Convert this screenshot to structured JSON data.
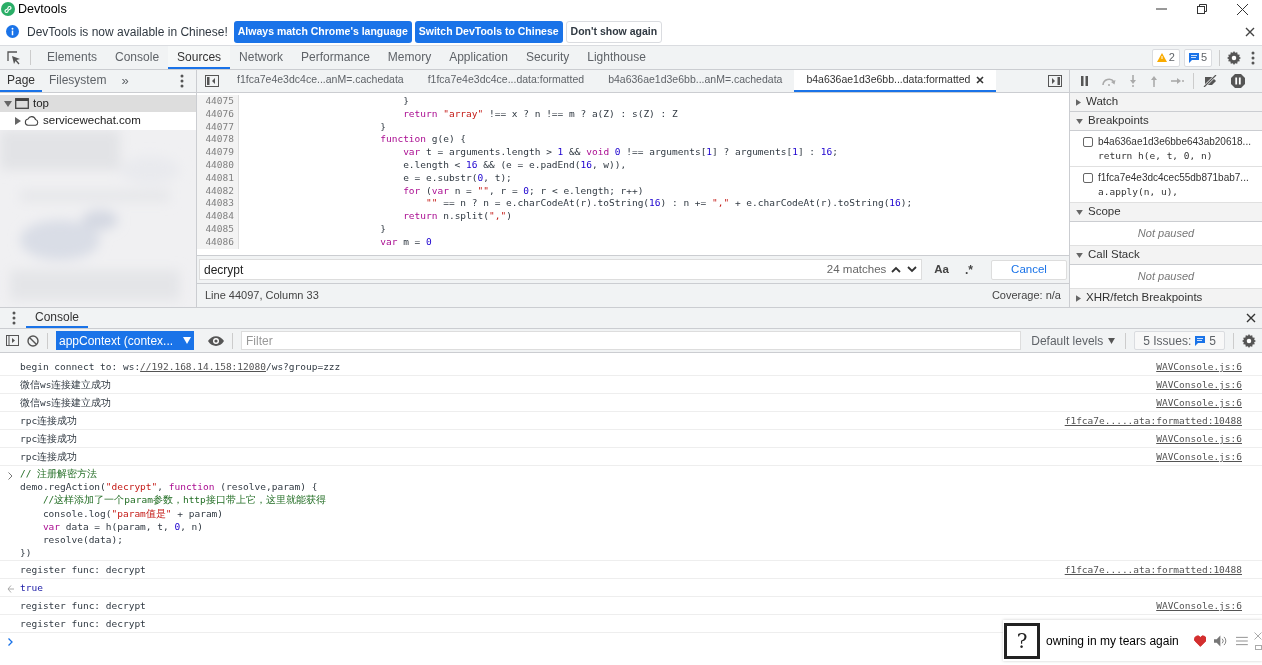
{
  "window": {
    "title": "Devtools"
  },
  "infobar": {
    "message": "DevTools is now available in Chinese!",
    "buttons": [
      {
        "label": "Always match Chrome's language",
        "primary": true
      },
      {
        "label": "Switch DevTools to Chinese",
        "primary": true
      },
      {
        "label": "Don't show again",
        "primary": false
      }
    ]
  },
  "main_tabs": [
    {
      "label": "Elements",
      "selected": false
    },
    {
      "label": "Console",
      "selected": false
    },
    {
      "label": "Sources",
      "selected": true
    },
    {
      "label": "Network",
      "selected": false
    },
    {
      "label": "Performance",
      "selected": false
    },
    {
      "label": "Memory",
      "selected": false
    },
    {
      "label": "Application",
      "selected": false
    },
    {
      "label": "Security",
      "selected": false
    },
    {
      "label": "Lighthouse",
      "selected": false
    }
  ],
  "badges": {
    "warnings": "2",
    "messages": "5"
  },
  "navigator": {
    "tabs": [
      {
        "label": "Page",
        "selected": true
      },
      {
        "label": "Filesystem",
        "selected": false
      }
    ],
    "more": "»",
    "tree": [
      {
        "label": "top",
        "kind": "frame",
        "selected": true,
        "expanded": true,
        "children": [
          {
            "label": "servicewechat.com",
            "kind": "domain",
            "selected": false,
            "expanded": false
          }
        ]
      }
    ]
  },
  "editor": {
    "tabs": [
      {
        "label": "f1fca7e4e3dc4ce...anM=.cachedata",
        "selected": false
      },
      {
        "label": "f1fca7e4e3dc4ce...data:formatted",
        "selected": false
      },
      {
        "label": "b4a636ae1d3e6bb...anM=.cachedata",
        "selected": false
      },
      {
        "label": "b4a636ae1d3e6bb...data:formatted",
        "selected": true
      }
    ],
    "lines": [
      {
        "number": "44075",
        "tokens": [
          {
            "kind": "plain",
            "text": "                            }"
          }
        ]
      },
      {
        "number": "44076",
        "tokens": [
          {
            "kind": "keyword",
            "text": "                            return"
          },
          {
            "kind": "string",
            "text": " \"array\""
          },
          {
            "kind": "plain",
            "text": " !== x ? n !== m ? a(Z) : s(Z) : Z"
          }
        ]
      },
      {
        "number": "44077",
        "tokens": [
          {
            "kind": "plain",
            "text": "                        }"
          }
        ]
      },
      {
        "number": "44078",
        "tokens": [
          {
            "kind": "keyword",
            "text": "                        function"
          },
          {
            "kind": "plain",
            "text": " g(e) {"
          }
        ]
      },
      {
        "number": "44079",
        "tokens": [
          {
            "kind": "keyword",
            "text": "                            var"
          },
          {
            "kind": "plain",
            "text": " t = arguments.length > "
          },
          {
            "kind": "number",
            "text": "1"
          },
          {
            "kind": "plain",
            "text": " && "
          },
          {
            "kind": "keyword",
            "text": "void"
          },
          {
            "kind": "number",
            "text": " 0"
          },
          {
            "kind": "plain",
            "text": " !== arguments["
          },
          {
            "kind": "number",
            "text": "1"
          },
          {
            "kind": "plain",
            "text": "] ? arguments["
          },
          {
            "kind": "number",
            "text": "1"
          },
          {
            "kind": "plain",
            "text": "] : "
          },
          {
            "kind": "number",
            "text": "16"
          },
          {
            "kind": "plain",
            "text": ";"
          }
        ]
      },
      {
        "number": "44080",
        "tokens": [
          {
            "kind": "plain",
            "text": "                            e.length < "
          },
          {
            "kind": "number",
            "text": "16"
          },
          {
            "kind": "plain",
            "text": " && (e = e.padEnd("
          },
          {
            "kind": "number",
            "text": "16"
          },
          {
            "kind": "plain",
            "text": ", w)),"
          }
        ]
      },
      {
        "number": "44081",
        "tokens": [
          {
            "kind": "plain",
            "text": "                            e = e.substr("
          },
          {
            "kind": "number",
            "text": "0"
          },
          {
            "kind": "plain",
            "text": ", t);"
          }
        ]
      },
      {
        "number": "44082",
        "tokens": [
          {
            "kind": "keyword",
            "text": "                            for"
          },
          {
            "kind": "plain",
            "text": " ("
          },
          {
            "kind": "keyword",
            "text": "var"
          },
          {
            "kind": "plain",
            "text": " n = "
          },
          {
            "kind": "string",
            "text": "\"\""
          },
          {
            "kind": "plain",
            "text": ", r = "
          },
          {
            "kind": "number",
            "text": "0"
          },
          {
            "kind": "plain",
            "text": "; r < e.length; r++)"
          }
        ]
      },
      {
        "number": "44083",
        "tokens": [
          {
            "kind": "string",
            "text": "                                \"\""
          },
          {
            "kind": "plain",
            "text": " == n ? n = e.charCodeAt(r).toString("
          },
          {
            "kind": "number",
            "text": "16"
          },
          {
            "kind": "plain",
            "text": ") : n += "
          },
          {
            "kind": "string",
            "text": "\",\""
          },
          {
            "kind": "plain",
            "text": " + e.charCodeAt(r).toString("
          },
          {
            "kind": "number",
            "text": "16"
          },
          {
            "kind": "plain",
            "text": ");"
          }
        ]
      },
      {
        "number": "44084",
        "tokens": [
          {
            "kind": "keyword",
            "text": "                            return"
          },
          {
            "kind": "plain",
            "text": " n.split("
          },
          {
            "kind": "string",
            "text": "\",\""
          },
          {
            "kind": "plain",
            "text": ")"
          }
        ]
      },
      {
        "number": "44085",
        "tokens": [
          {
            "kind": "plain",
            "text": "                        }"
          }
        ]
      },
      {
        "number": "44086",
        "tokens": [
          {
            "kind": "keyword",
            "text": "                        var"
          },
          {
            "kind": "plain",
            "text": " m = "
          },
          {
            "kind": "number",
            "text": "0"
          }
        ]
      }
    ],
    "search": {
      "value": "decrypt",
      "matches": "24 matches",
      "case_label": "Aa",
      "regex_label": ".*",
      "cancel": "Cancel"
    },
    "status": {
      "position": "Line 44097, Column 33",
      "coverage": "Coverage: n/a"
    }
  },
  "debugger": {
    "sections": [
      {
        "title": "Watch",
        "expanded": false
      },
      {
        "title": "Breakpoints",
        "expanded": true,
        "breakpoints": [
          {
            "file": "b4a636ae1d3e6bbe643ab20618...",
            "code": "return h(e, t, 0, n)",
            "checked": false
          },
          {
            "file": "f1fca7e4e3dc4cec55db871bab7...",
            "code": "a.apply(n, u),",
            "checked": false
          }
        ]
      },
      {
        "title": "Scope",
        "expanded": true,
        "empty": "Not paused"
      },
      {
        "title": "Call Stack",
        "expanded": true,
        "empty": "Not paused"
      },
      {
        "title": "XHR/fetch Breakpoints",
        "expanded": false
      }
    ]
  },
  "console": {
    "drawer_tab": "Console",
    "context": "appContext (contex...",
    "filter_placeholder": "Filter",
    "levels": "Default levels",
    "issues_label": "5 Issues:",
    "issues_count": "5",
    "messages": [
      {
        "kind": "log",
        "source": "WAVConsole.js:6",
        "lines": [
          [
            {
              "kind": "plain",
              "text": "begin connect to: ws:"
            },
            {
              "kind": "link",
              "text": "//192.168.14.158:12080"
            },
            {
              "kind": "plain",
              "text": "/ws?group=zzz"
            }
          ]
        ]
      },
      {
        "kind": "log",
        "source": "WAVConsole.js:6",
        "lines": [
          [
            {
              "kind": "plain",
              "text": "微信ws连接建立成功"
            }
          ]
        ]
      },
      {
        "kind": "log",
        "source": "WAVConsole.js:6",
        "lines": [
          [
            {
              "kind": "plain",
              "text": "微信ws连接建立成功"
            }
          ]
        ]
      },
      {
        "kind": "log",
        "source": "f1fca7e.....ata:formatted:10488",
        "lines": [
          [
            {
              "kind": "plain",
              "text": "rpc连接成功"
            }
          ]
        ]
      },
      {
        "kind": "log",
        "source": "WAVConsole.js:6",
        "lines": [
          [
            {
              "kind": "plain",
              "text": "rpc连接成功"
            }
          ]
        ]
      },
      {
        "kind": "log",
        "source": "WAVConsole.js:6",
        "lines": [
          [
            {
              "kind": "plain",
              "text": "rpc连接成功"
            }
          ]
        ]
      },
      {
        "kind": "input",
        "lines": [
          [
            {
              "kind": "comment",
              "text": "// 注册解密方法"
            }
          ],
          [
            {
              "kind": "plain",
              "text": "demo.regAction("
            },
            {
              "kind": "string",
              "text": "\"decrypt\""
            },
            {
              "kind": "plain",
              "text": ", "
            },
            {
              "kind": "keyword",
              "text": "function"
            },
            {
              "kind": "plain",
              "text": " (resolve,param) {"
            }
          ],
          [
            {
              "kind": "comment",
              "text": "    //这样添加了一个param参数，http接口带上它，这里就能获得"
            }
          ],
          [
            {
              "kind": "plain",
              "text": "    console.log("
            },
            {
              "kind": "string",
              "text": "\"param值是\""
            },
            {
              "kind": "plain",
              "text": " + param)"
            }
          ],
          [
            {
              "kind": "keyword",
              "text": "    var"
            },
            {
              "kind": "plain",
              "text": " data = h(param, t, "
            },
            {
              "kind": "number",
              "text": "0"
            },
            {
              "kind": "plain",
              "text": ", n)"
            }
          ],
          [
            {
              "kind": "plain",
              "text": "    resolve(data);"
            }
          ],
          [
            {
              "kind": "plain",
              "text": "})"
            }
          ]
        ]
      },
      {
        "kind": "log",
        "source": "f1fca7e.....ata:formatted:10488",
        "lines": [
          [
            {
              "kind": "plain",
              "text": "register func: decrypt"
            }
          ]
        ]
      },
      {
        "kind": "result",
        "lines": [
          [
            {
              "kind": "boolean",
              "text": "true"
            }
          ]
        ]
      },
      {
        "kind": "log",
        "source": "WAVConsole.js:6",
        "lines": [
          [
            {
              "kind": "plain",
              "text": "register func: decrypt"
            }
          ]
        ]
      },
      {
        "kind": "log",
        "lines": [
          [
            {
              "kind": "plain",
              "text": "register func: decrypt"
            }
          ]
        ]
      }
    ]
  },
  "player": {
    "art": "?",
    "track": "owning in my tears again",
    "liked": true
  }
}
